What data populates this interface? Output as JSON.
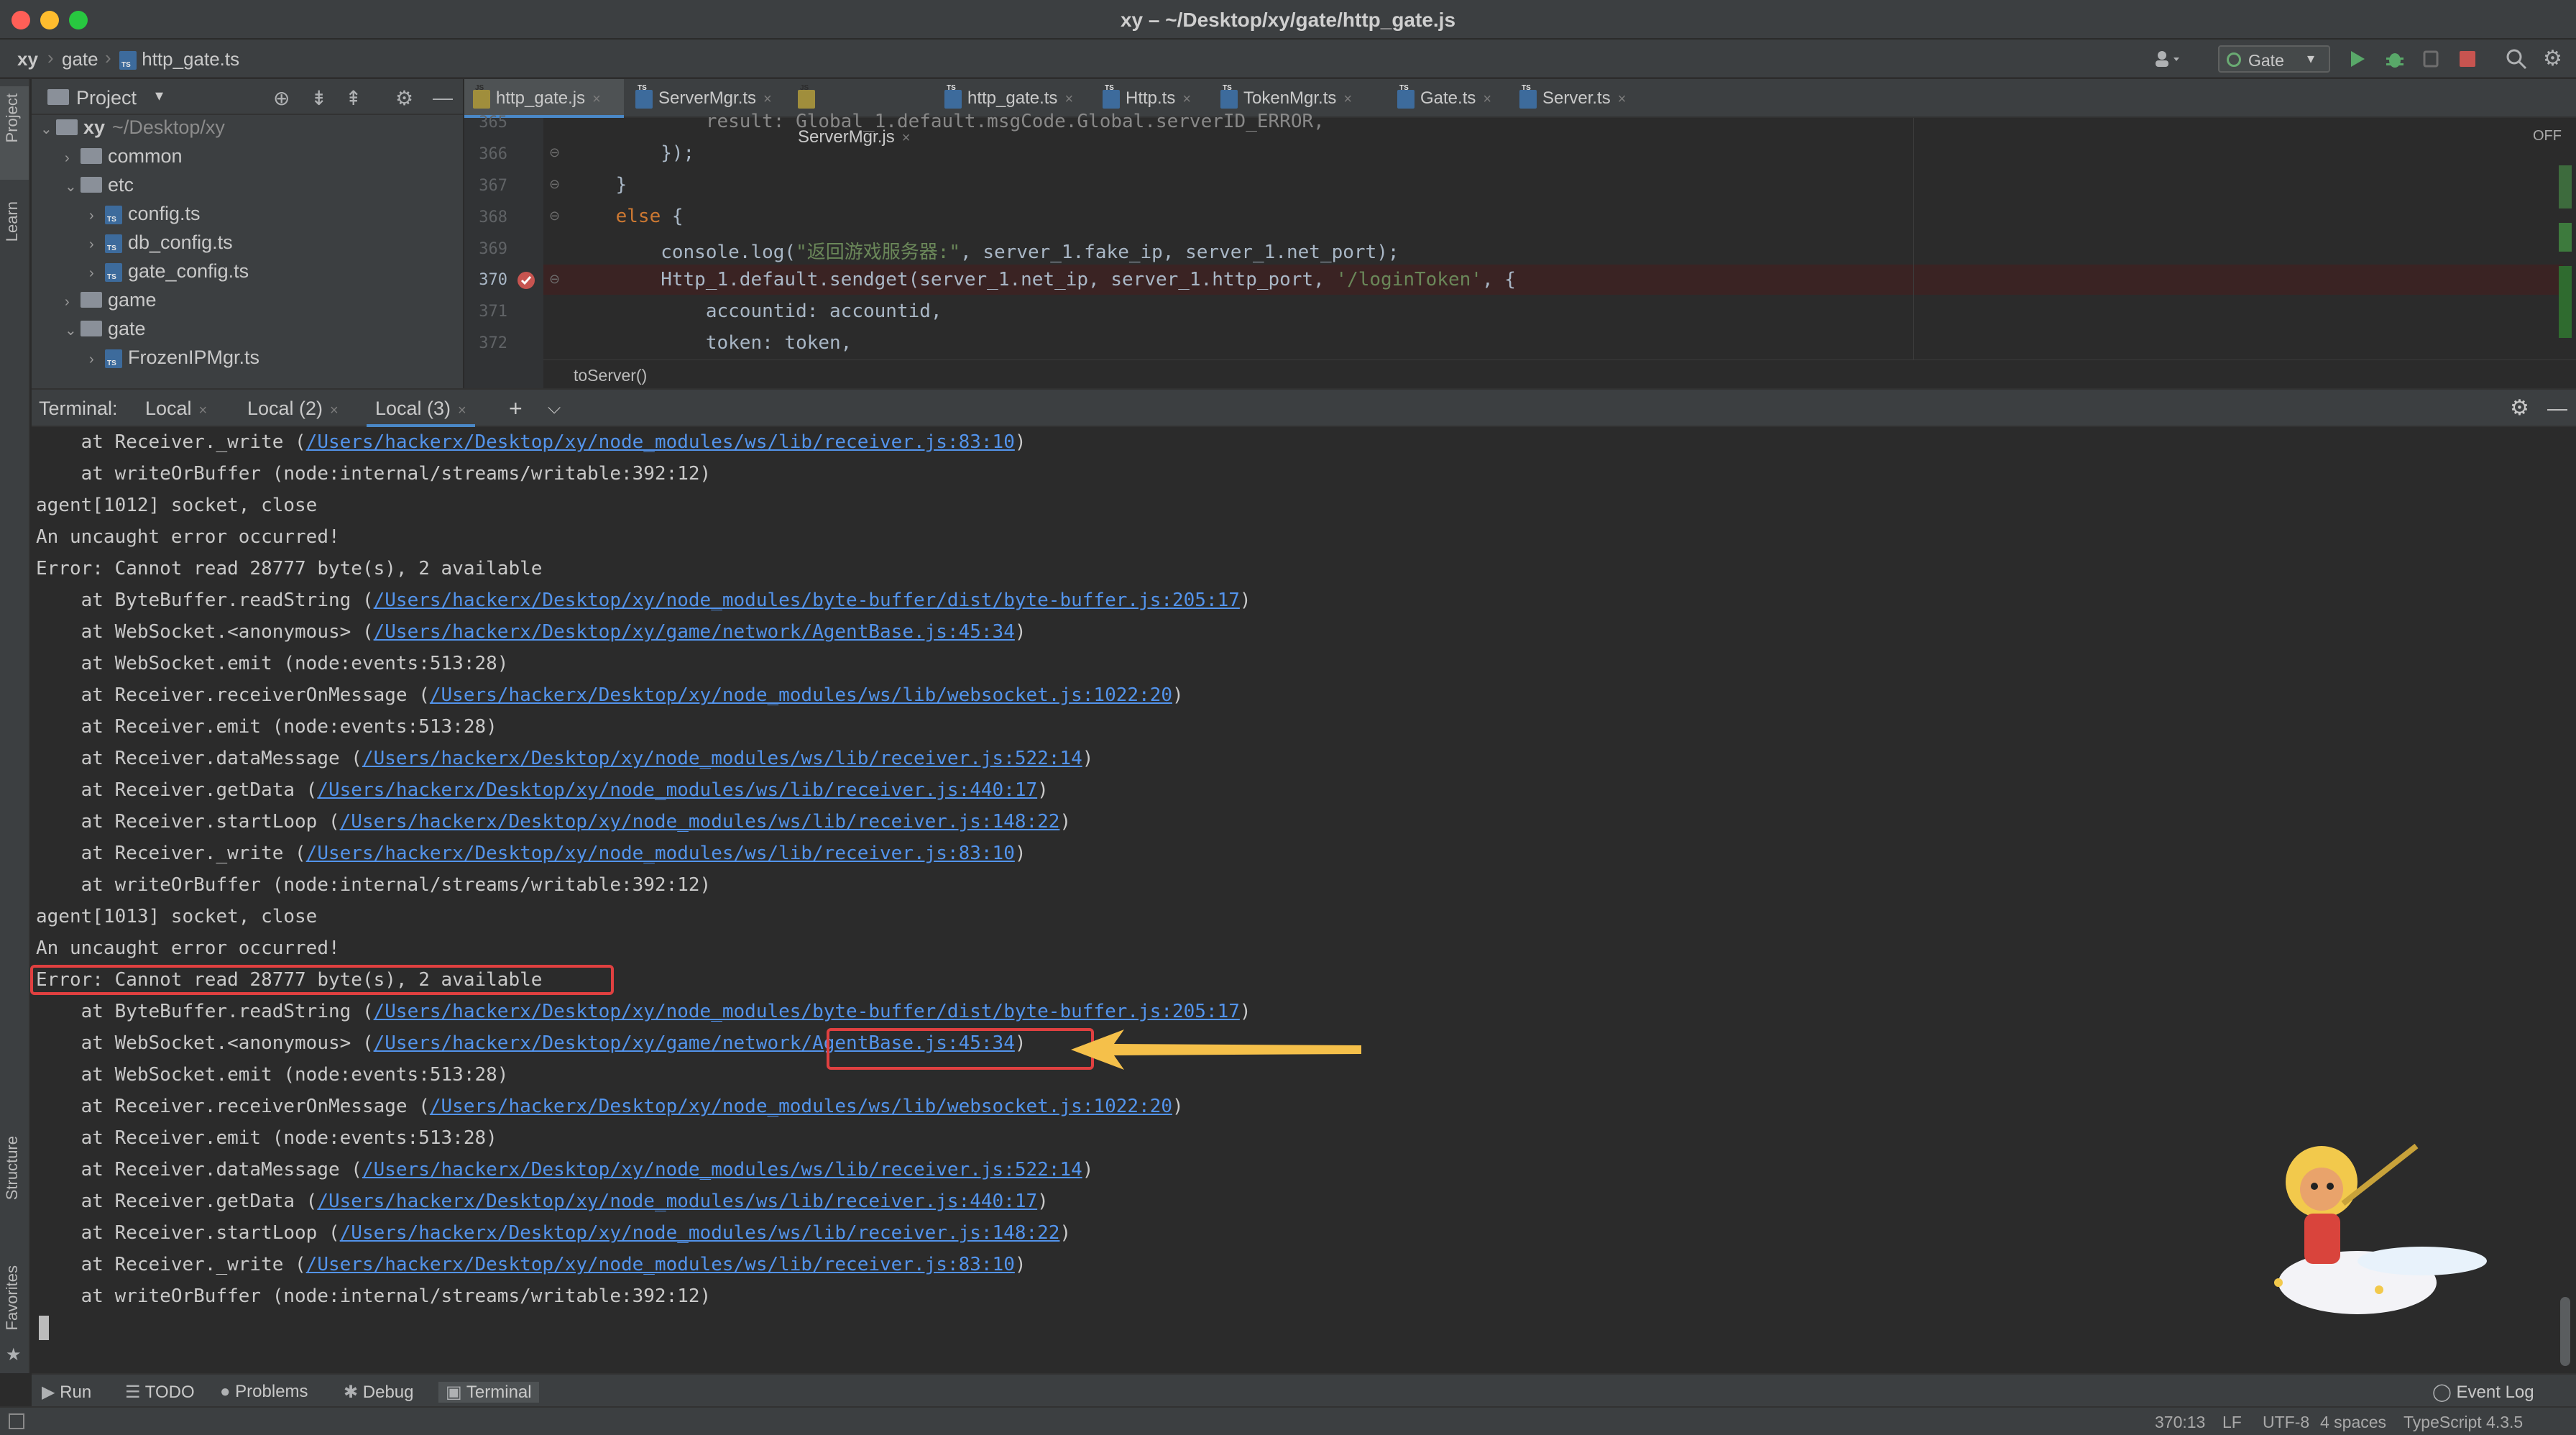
{
  "window": {
    "title": "xy – ~/Desktop/xy/gate/http_gate.js",
    "colors": {
      "close": "#ff5f57",
      "minimize": "#febc2e",
      "zoom": "#28c840"
    }
  },
  "breadcrumb": {
    "root": "xy",
    "folder": "gate",
    "file": "http_gate.ts"
  },
  "toolbar": {
    "run_config": "Gate",
    "user_icon": "user-icon",
    "run_icon": "play-icon",
    "debug_icon": "bug-icon",
    "stop_icon": "stop-icon",
    "search_icon": "search-icon",
    "settings_icon": "gear-icon"
  },
  "left_strip": {
    "project": "Project",
    "learn": "Learn",
    "structure": "Structure",
    "favorites": "Favorites"
  },
  "project_panel": {
    "title": "Project",
    "tree": [
      {
        "label": "xy",
        "path": "~/Desktop/xy",
        "kind": "folder",
        "expanded": true
      },
      {
        "label": "common",
        "kind": "folder",
        "expanded": false
      },
      {
        "label": "etc",
        "kind": "folder",
        "expanded": true
      },
      {
        "label": "config.ts",
        "kind": "ts"
      },
      {
        "label": "db_config.ts",
        "kind": "ts"
      },
      {
        "label": "gate_config.ts",
        "kind": "ts"
      },
      {
        "label": "game",
        "kind": "folder",
        "expanded": false
      },
      {
        "label": "gate",
        "kind": "folder",
        "expanded": true
      },
      {
        "label": "FrozenIPMgr.ts",
        "kind": "ts"
      }
    ]
  },
  "editor_tabs": [
    {
      "label": "http_gate.js",
      "kind": "js",
      "active": true
    },
    {
      "label": "ServerMgr.ts",
      "kind": "ts"
    },
    {
      "label": "ServerMgr.js",
      "kind": "js"
    },
    {
      "label": "http_gate.ts",
      "kind": "ts"
    },
    {
      "label": "Http.ts",
      "kind": "ts"
    },
    {
      "label": "TokenMgr.ts",
      "kind": "ts"
    },
    {
      "label": "Gate.ts",
      "kind": "ts"
    },
    {
      "label": "Server.ts",
      "kind": "ts"
    }
  ],
  "editor": {
    "off_label": "OFF",
    "function_breadcrumb": "toServer()",
    "line_numbers": [
      "365",
      "366",
      "367",
      "368",
      "369",
      "370",
      "371",
      "372"
    ],
    "lines": {
      "l365": "            result: Global_1.default.msgCode.Global.serverID_ERROR,",
      "l366": "        });",
      "l367": "    }",
      "l368_kw": "else",
      "l368_rest": " {",
      "l369_a": "        console.log(",
      "l369_str": "\"返回游戏服务器:\"",
      "l369_b": ", server_1.fake_ip, server_1.net_port);",
      "l370_a": "        Http_1.default.sendget(server_1.net_ip, server_1.http_port, ",
      "l370_str": "'/loginToken'",
      "l370_b": ", {",
      "l371": "            accountid: accountid,",
      "l372": "            token: token,"
    }
  },
  "terminal": {
    "label": "Terminal:",
    "tabs": [
      "Local",
      "Local (2)",
      "Local (3)"
    ],
    "lines": [
      {
        "pre": "    at Receiver._write (",
        "link": "/Users/hackerx/Desktop/xy/node_modules/ws/lib/receiver.js:83:10",
        "post": ")"
      },
      {
        "pre": "    at writeOrBuffer (node:internal/streams/writable:392:12)"
      },
      {
        "pre": "agent[1012] socket, close"
      },
      {
        "pre": "An uncaught error occurred!"
      },
      {
        "pre": "Error: Cannot read 28777 byte(s), 2 available"
      },
      {
        "pre": "    at ByteBuffer.readString (",
        "link": "/Users/hackerx/Desktop/xy/node_modules/byte-buffer/dist/byte-buffer.js:205:17",
        "post": ")"
      },
      {
        "pre": "    at WebSocket.<anonymous> (",
        "link": "/Users/hackerx/Desktop/xy/game/network/AgentBase.js:45:34",
        "post": ")"
      },
      {
        "pre": "    at WebSocket.emit (node:events:513:28)"
      },
      {
        "pre": "    at Receiver.receiverOnMessage (",
        "link": "/Users/hackerx/Desktop/xy/node_modules/ws/lib/websocket.js:1022:20",
        "post": ")"
      },
      {
        "pre": "    at Receiver.emit (node:events:513:28)"
      },
      {
        "pre": "    at Receiver.dataMessage (",
        "link": "/Users/hackerx/Desktop/xy/node_modules/ws/lib/receiver.js:522:14",
        "post": ")"
      },
      {
        "pre": "    at Receiver.getData (",
        "link": "/Users/hackerx/Desktop/xy/node_modules/ws/lib/receiver.js:440:17",
        "post": ")"
      },
      {
        "pre": "    at Receiver.startLoop (",
        "link": "/Users/hackerx/Desktop/xy/node_modules/ws/lib/receiver.js:148:22",
        "post": ")"
      },
      {
        "pre": "    at Receiver._write (",
        "link": "/Users/hackerx/Desktop/xy/node_modules/ws/lib/receiver.js:83:10",
        "post": ")"
      },
      {
        "pre": "    at writeOrBuffer (node:internal/streams/writable:392:12)"
      },
      {
        "pre": "agent[1013] socket, close"
      },
      {
        "pre": "An uncaught error occurred!"
      },
      {
        "pre": "Error: Cannot read 28777 byte(s), 2 available"
      },
      {
        "pre": "    at ByteBuffer.readString (",
        "link": "/Users/hackerx/Desktop/xy/node_modules/byte-buffer/dist/byte-buffer.js:205:17",
        "post": ")"
      },
      {
        "pre": "    at WebSocket.<anonymous> (",
        "link": "/Users/hackerx/Desktop/xy/game/network/AgentBase.js:45:34",
        "post": ")"
      },
      {
        "pre": "    at WebSocket.emit (node:events:513:28)"
      },
      {
        "pre": "    at Receiver.receiverOnMessage (",
        "link": "/Users/hackerx/Desktop/xy/node_modules/ws/lib/websocket.js:1022:20",
        "post": ")"
      },
      {
        "pre": "    at Receiver.emit (node:events:513:28)"
      },
      {
        "pre": "    at Receiver.dataMessage (",
        "link": "/Users/hackerx/Desktop/xy/node_modules/ws/lib/receiver.js:522:14",
        "post": ")"
      },
      {
        "pre": "    at Receiver.getData (",
        "link": "/Users/hackerx/Desktop/xy/node_modules/ws/lib/receiver.js:440:17",
        "post": ")"
      },
      {
        "pre": "    at Receiver.startLoop (",
        "link": "/Users/hackerx/Desktop/xy/node_modules/ws/lib/receiver.js:148:22",
        "post": ")"
      },
      {
        "pre": "    at Receiver._write (",
        "link": "/Users/hackerx/Desktop/xy/node_modules/ws/lib/receiver.js:83:10",
        "post": ")"
      },
      {
        "pre": "    at writeOrBuffer (node:internal/streams/writable:392:12)"
      }
    ]
  },
  "tool_windows": [
    "Run",
    "TODO",
    "Problems",
    "Debug",
    "Terminal"
  ],
  "event_log": "Event Log",
  "status": {
    "position": "370:13",
    "line_sep": "LF",
    "encoding": "UTF-8",
    "indent": "4 spaces",
    "language": "TypeScript 4.3.5"
  },
  "annotation_colors": {
    "highlight_box": "#e04040",
    "arrow": "#f5c04a"
  }
}
